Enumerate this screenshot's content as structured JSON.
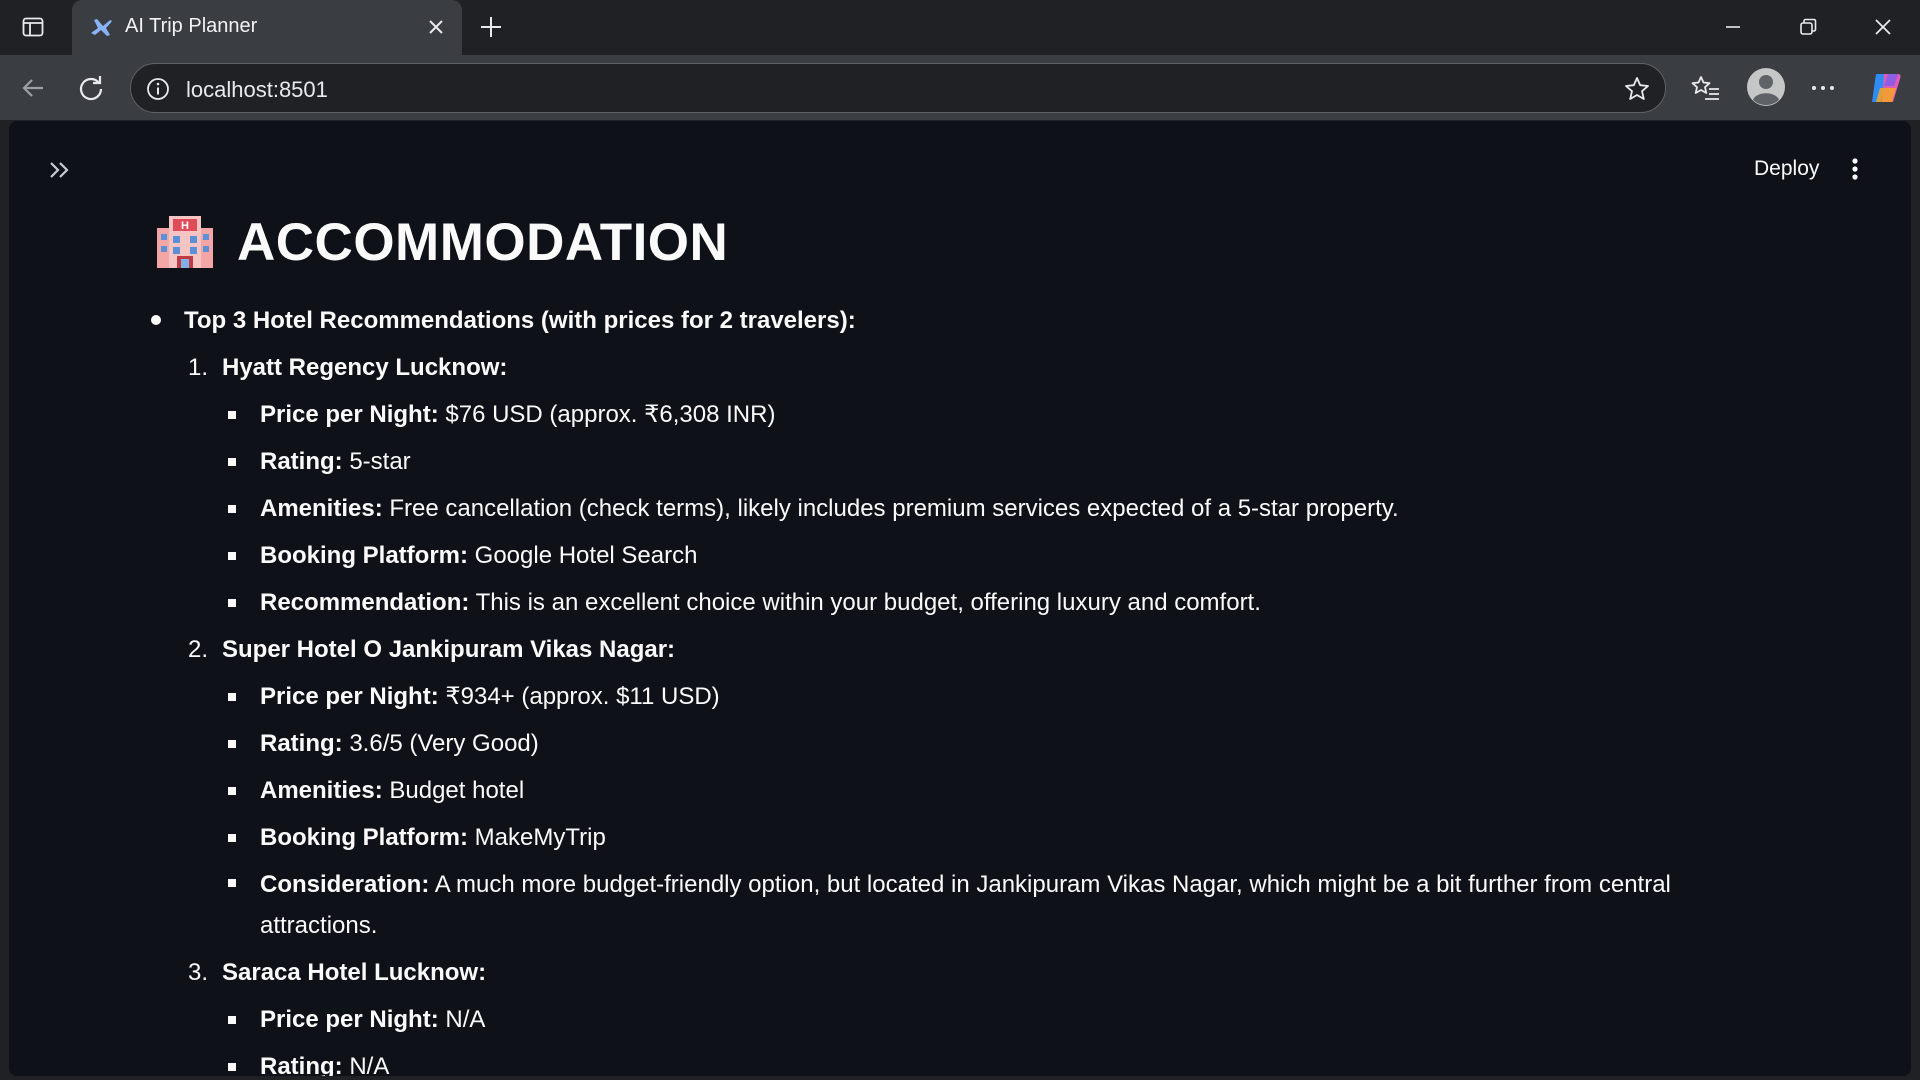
{
  "browser": {
    "tab_title": "AI Trip Planner",
    "url": "localhost:8501"
  },
  "app": {
    "deploy_label": "Deploy",
    "heading": "ACCOMMODATION",
    "heading_emoji": "hotel",
    "intro": "Top 3 Hotel Recommendations (with prices for 2 travelers):",
    "hotels": [
      {
        "number": "1.",
        "name": "Hyatt Regency Lucknow:",
        "details": [
          {
            "label": "Price per Night:",
            "value": " $76 USD (approx. ₹6,308 INR)"
          },
          {
            "label": "Rating:",
            "value": " 5-star"
          },
          {
            "label": "Amenities:",
            "value": " Free cancellation (check terms), likely includes premium services expected of a 5-star property."
          },
          {
            "label": "Booking Platform:",
            "value": " Google Hotel Search"
          },
          {
            "label": "Recommendation:",
            "value": " This is an excellent choice within your budget, offering luxury and comfort."
          }
        ]
      },
      {
        "number": "2.",
        "name": "Super Hotel O Jankipuram Vikas Nagar:",
        "details": [
          {
            "label": "Price per Night:",
            "value": " ₹934+ (approx. $11 USD)"
          },
          {
            "label": "Rating:",
            "value": " 3.6/5 (Very Good)"
          },
          {
            "label": "Amenities:",
            "value": " Budget hotel"
          },
          {
            "label": "Booking Platform:",
            "value": " MakeMyTrip"
          },
          {
            "label": "Consideration:",
            "value": " A much more budget-friendly option, but located in Jankipuram Vikas Nagar, which might be a bit further from central attractions."
          }
        ]
      },
      {
        "number": "3.",
        "name": "Saraca Hotel Lucknow:",
        "details": [
          {
            "label": "Price per Night:",
            "value": " N/A"
          },
          {
            "label": "Rating:",
            "value": " N/A"
          }
        ]
      }
    ]
  },
  "colors": {
    "app_background": "#0e1117",
    "text": "#fafafa",
    "chrome_dark": "#202124",
    "chrome_light": "#3a3d41"
  }
}
